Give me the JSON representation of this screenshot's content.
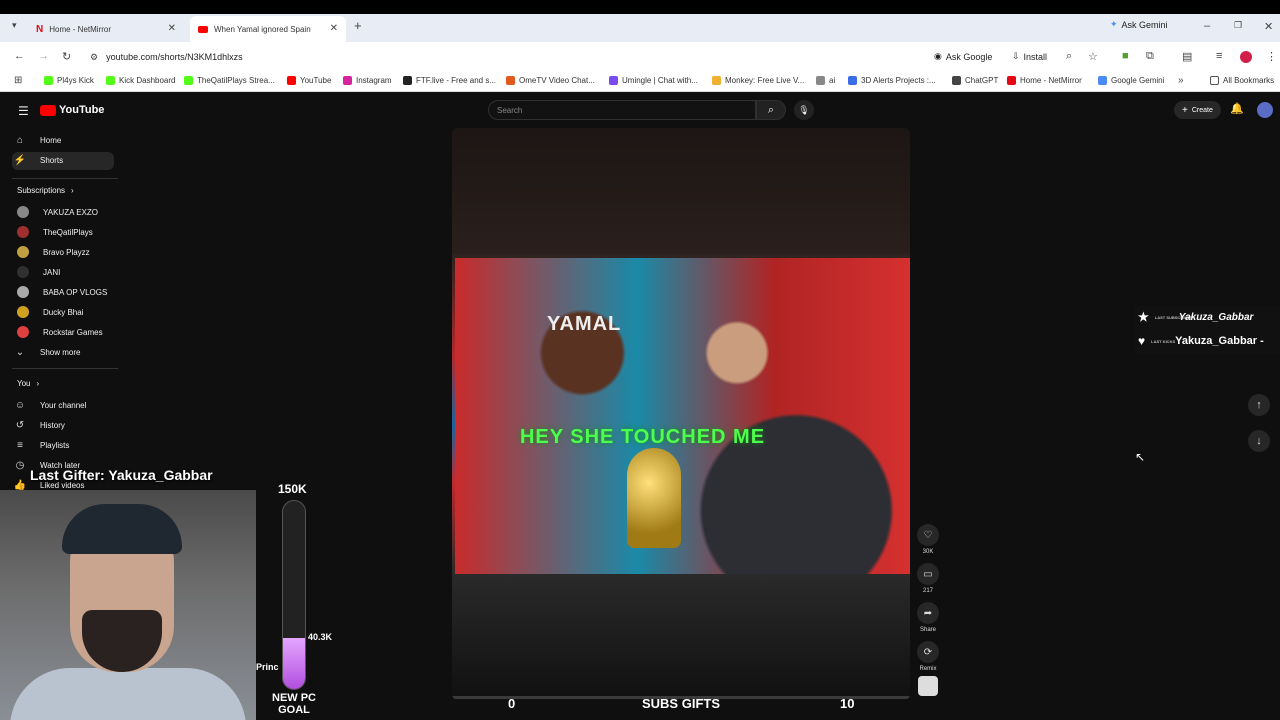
{
  "browser": {
    "tabs": [
      {
        "title": "Home - NetMirror"
      },
      {
        "title": "When Yamal ignored Spain"
      }
    ],
    "new_tab_symbol": "+",
    "ask_gemini": "Ask Gemini",
    "url": "youtube.com/shorts/N3KM1dhlxzs",
    "ask_google": "Ask Google",
    "install": "Install",
    "bookmarks": [
      {
        "label": "Pl4ys Kick",
        "color": "#53fc18"
      },
      {
        "label": "Kick Dashboard",
        "color": "#53fc18"
      },
      {
        "label": "TheQatilPlays Strea...",
        "color": "#53fc18"
      },
      {
        "label": "YouTube",
        "color": "#ff0000"
      },
      {
        "label": "Instagram",
        "color": "#d6249f"
      },
      {
        "label": "FTF.live - Free and s...",
        "color": "#222222"
      },
      {
        "label": "OmeTV Video Chat...",
        "color": "#e05a1e"
      },
      {
        "label": "Umingle | Chat with...",
        "color": "#7a4cf0"
      },
      {
        "label": "Monkey: Free Live V...",
        "color": "#f0b030"
      },
      {
        "label": "ai",
        "color": "#888888"
      },
      {
        "label": "3D Alerts Projects :...",
        "color": "#3a6ee8"
      },
      {
        "label": "ChatGPT",
        "color": "#444444"
      },
      {
        "label": "Home - NetMirror",
        "color": "#e50914"
      },
      {
        "label": "Google Gemini",
        "color": "#4b8bf5"
      }
    ],
    "all_bookmarks": "All Bookmarks"
  },
  "youtube": {
    "logo": "YouTube",
    "search_placeholder": "Search",
    "create": "Create",
    "sidebar": {
      "home": "Home",
      "shorts": "Shorts",
      "subscriptions": "Subscriptions",
      "channels": [
        {
          "name": "YAKUZA EXZO",
          "color": "#888888"
        },
        {
          "name": "TheQatilPlays",
          "color": "#a03030"
        },
        {
          "name": "Bravo Playzz",
          "color": "#c0a040"
        },
        {
          "name": "JANI",
          "color": "#303030"
        },
        {
          "name": "BABA OP VLOGS",
          "color": "#aaaaaa"
        },
        {
          "name": "Ducky Bhai",
          "color": "#d0a020"
        },
        {
          "name": "Rockstar Games",
          "color": "#e04040"
        }
      ],
      "show_more": "Show more",
      "you": "You",
      "your_channel": "Your channel",
      "history": "History",
      "playlists": "Playlists",
      "watch_later": "Watch later",
      "liked_videos": "Liked videos"
    },
    "video": {
      "overlay_name": "YAMAL",
      "caption": "HEY SHE TOUCHED ME"
    },
    "actions": {
      "likes": "30K",
      "comments": "217",
      "share": "Share",
      "remix": "Remix"
    }
  },
  "stream_overlay": {
    "last_gifter": "Last Gifter: Yakuza_Gabbar",
    "goal_target": "150K",
    "goal_current": "40.3K",
    "goal_fraction": 0.27,
    "goal_label": "NEW PC GOAL",
    "viewer_name": "Princ",
    "counter_left": "0",
    "counter_mid": "SUBS GIFTS",
    "counter_right": "10",
    "alerts": [
      {
        "tag": "LAST SUBSCRIBER",
        "name": "Yakuza_Gabbar"
      },
      {
        "tag": "LAST KICKS",
        "name": "Yakuza_Gabbar -"
      }
    ]
  }
}
